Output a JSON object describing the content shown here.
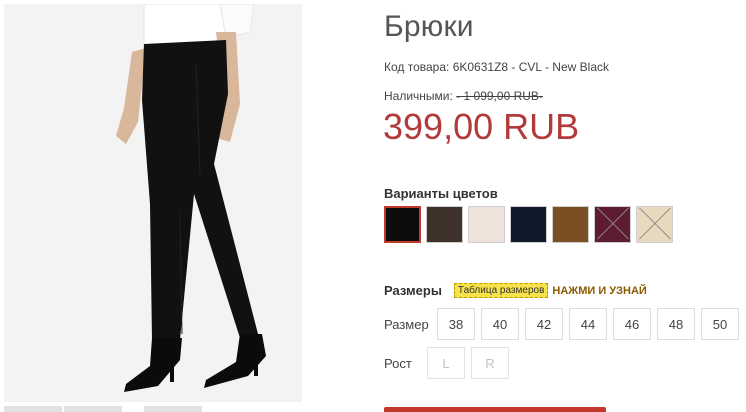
{
  "product": {
    "title": "Брюки",
    "sku": "Код товара: 6K0631Z8 - CVL - New Black",
    "old_price_label": "Наличными:",
    "old_price": "1 099,00 RUB",
    "price": "399,00 RUB"
  },
  "colors": {
    "label": "Варианты цветов",
    "swatches": [
      {
        "color": "#0d0d0d",
        "selected": true,
        "available": true
      },
      {
        "color": "#3e322a",
        "selected": false,
        "available": true
      },
      {
        "color": "#efe2da",
        "selected": false,
        "available": true
      },
      {
        "color": "#111a2b",
        "selected": false,
        "available": true
      },
      {
        "color": "#7a4f24",
        "selected": false,
        "available": true
      },
      {
        "color": "#5d1c32",
        "selected": false,
        "available": false
      },
      {
        "color": "#e8d8bd",
        "selected": false,
        "available": false
      }
    ]
  },
  "sizes": {
    "label": "Размеры",
    "chart_link": "Таблица размеров",
    "cta": "НАЖМИ И УЗНАЙ",
    "size_label": "Размер",
    "values": [
      "38",
      "40",
      "42",
      "44",
      "46",
      "48",
      "50"
    ],
    "height_label": "Рост",
    "heights": [
      "L",
      "R"
    ]
  },
  "theme": {
    "price_color": "#b13a3a",
    "accent": "#c0392b"
  }
}
